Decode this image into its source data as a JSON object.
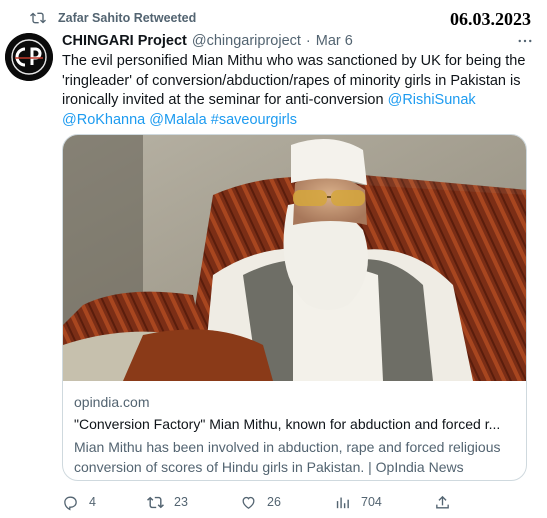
{
  "stamp": {
    "date": "06.03.2023"
  },
  "retweet": {
    "label": "Zafar Sahito Retweeted",
    "icon": "retweet-icon"
  },
  "author": {
    "name": "CHINGARI Project",
    "handle": "@chingariproject",
    "separator": "·",
    "time": "Mar 6",
    "avatar_text": "CP",
    "more_icon": "more-icon"
  },
  "tweet": {
    "text": "The evil personified Mian Mithu who was sanctioned by UK for being the 'ringleader' of conversion/abduction/rapes of minority girls in Pakistan is ironically invited at the seminar for anti-conversion ",
    "mentions": [
      "@RishiSunak",
      "@RoKhanna",
      "@Malala"
    ],
    "hashtag": "#saveourgirls"
  },
  "card": {
    "domain": "opindia.com",
    "title": "\"Conversion Factory\" Mian Mithu, known for abduction and forced r...",
    "description": "Mian Mithu has been involved in abduction, rape and forced religious conversion of scores of Hindu girls in Pakistan. | OpIndia News"
  },
  "actions": {
    "reply": {
      "count": "4",
      "icon": "reply-icon"
    },
    "retweet": {
      "count": "23",
      "icon": "retweet-icon"
    },
    "like": {
      "count": "26",
      "icon": "heart-icon"
    },
    "views": {
      "count": "704",
      "icon": "views-icon"
    },
    "share": {
      "icon": "share-icon"
    }
  },
  "colors": {
    "link": "#1d9bf0",
    "muted": "#536471",
    "text": "#0f1419",
    "border": "#cfd9de"
  }
}
